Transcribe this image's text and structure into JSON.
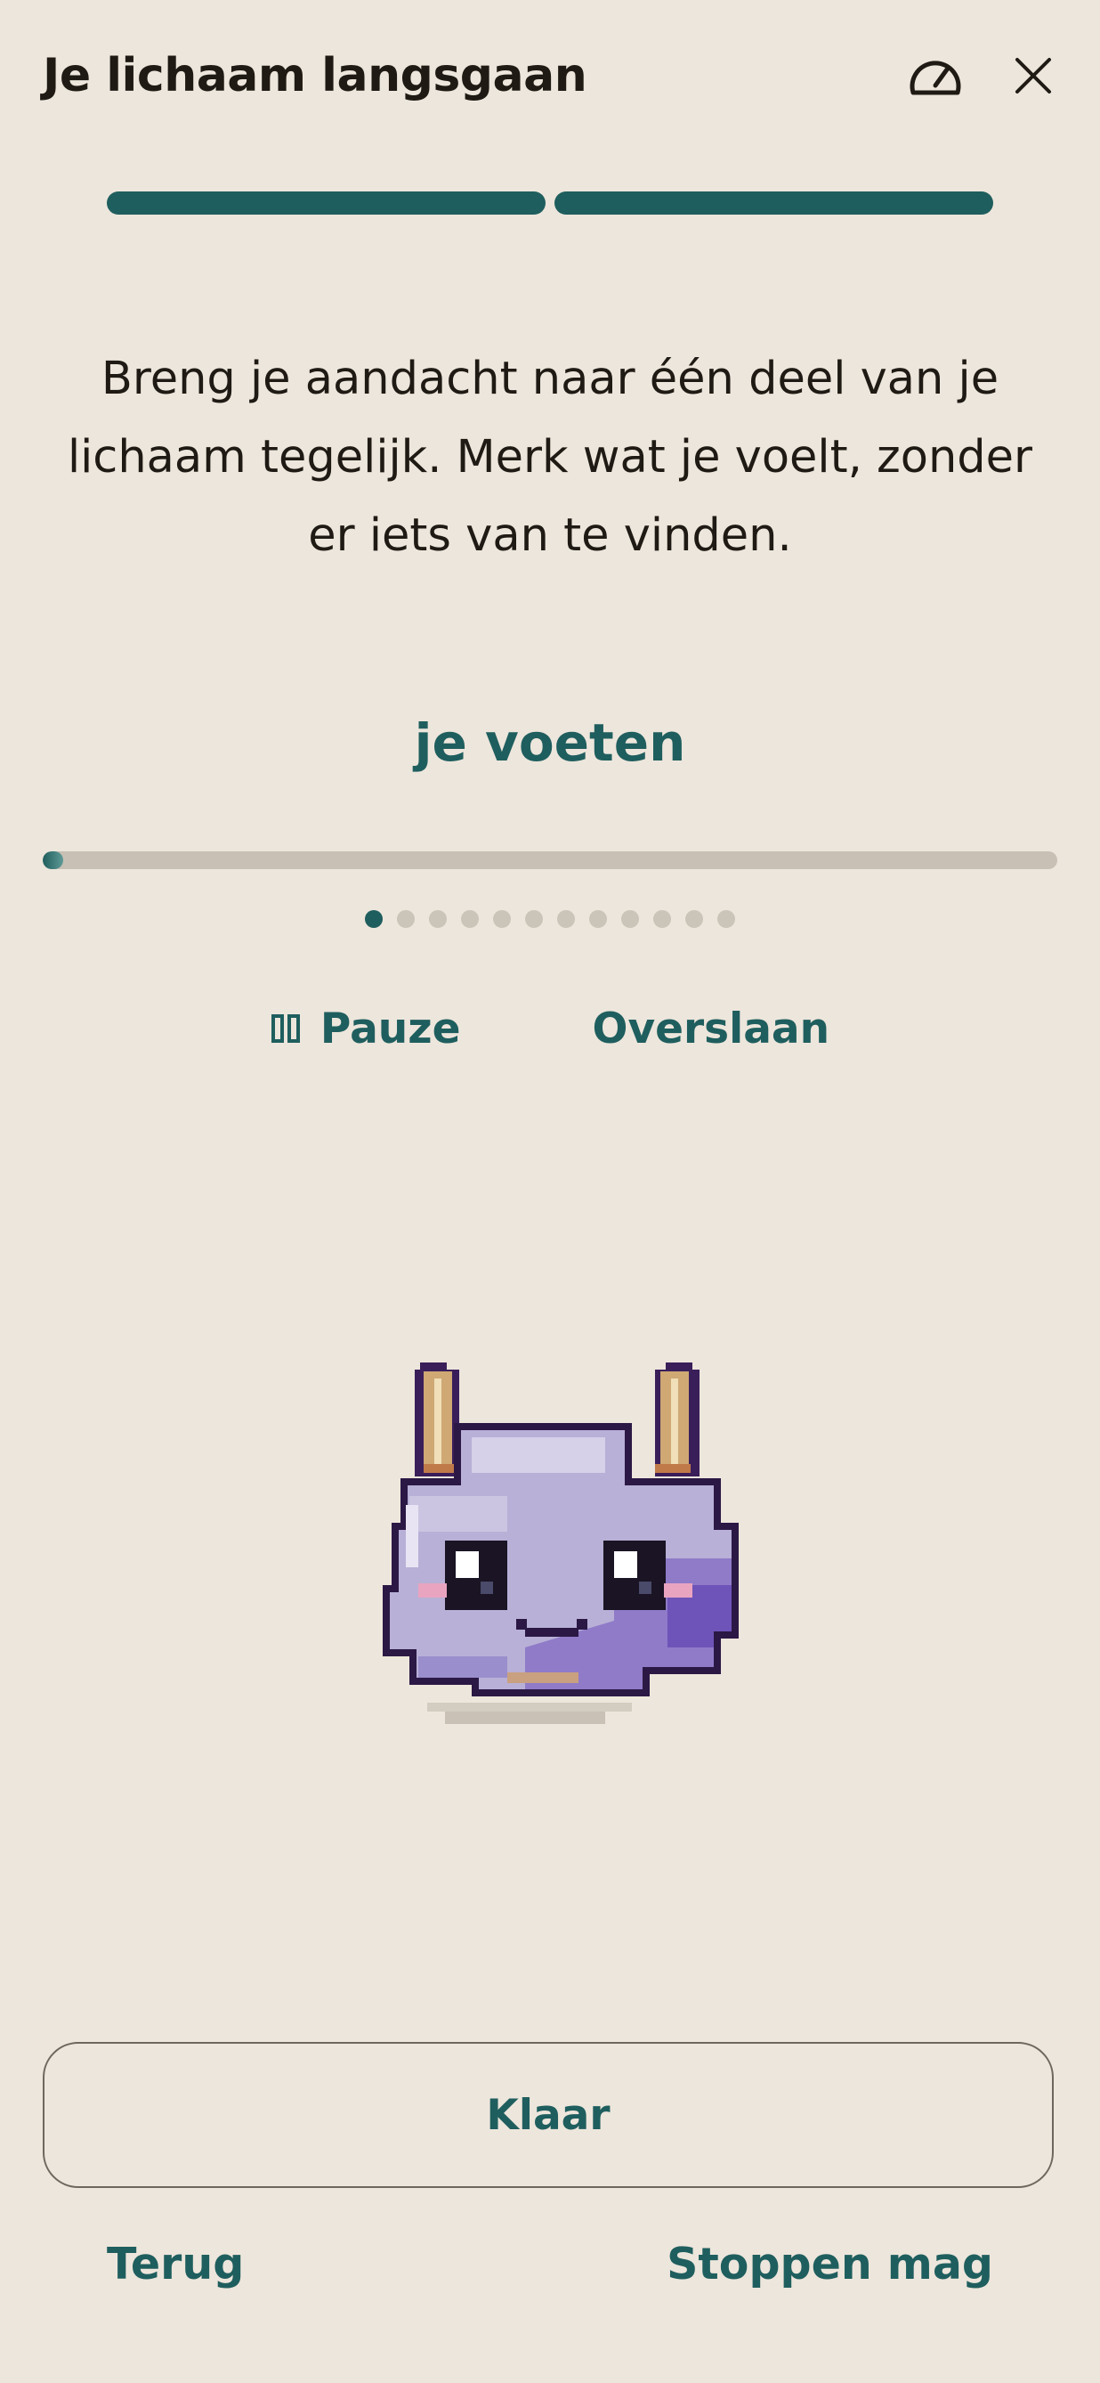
{
  "header": {
    "title": "Je lichaam langsgaan",
    "speed_icon": "speedometer-icon",
    "close_icon": "close-icon"
  },
  "steps": {
    "total": 2,
    "completed": 2
  },
  "instruction": "Breng je aandacht naar één deel van je lichaam tegelijk. Merk wat je voelt, zonder er iets van te vinden.",
  "current_part": "je voeten",
  "progress": {
    "fraction": 0.012
  },
  "dots": {
    "total": 12,
    "active": 0
  },
  "controls": {
    "pause_label": "Pauze",
    "pause_icon": "pause-icon",
    "skip_label": "Overslaan"
  },
  "mascot": {
    "name": "pixel-creature-mascot"
  },
  "done_label": "Klaar",
  "footer": {
    "back_label": "Terug",
    "stop_label": "Stoppen mag"
  },
  "colors": {
    "background": "#ede6dc",
    "accent": "#1f5e5e",
    "text": "#1f1a14",
    "track": "#c8c0b4",
    "inactive_dot": "#cbc4b8"
  }
}
